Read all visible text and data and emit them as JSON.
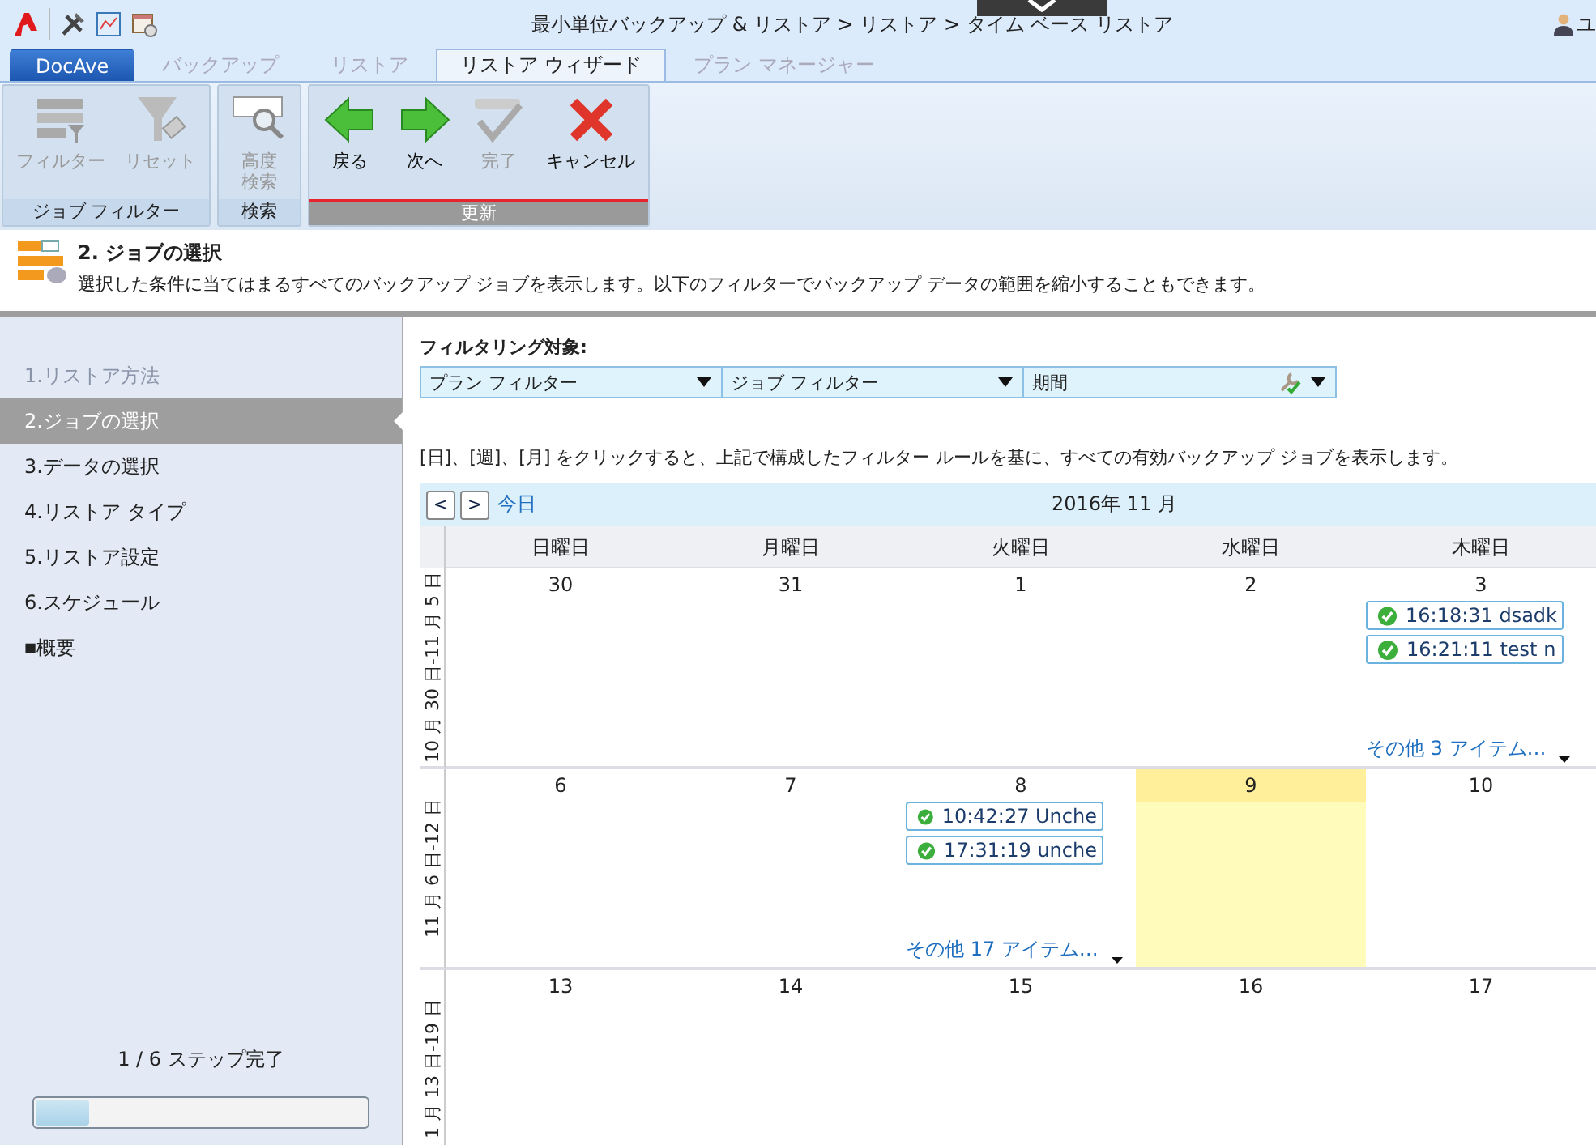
{
  "top_bar": {
    "breadcrumb": "最小単位バックアップ & リストア > リストア > タイム ベース リストア",
    "user": "ユ"
  },
  "tabs": [
    {
      "label": "DocAve",
      "kind": "app",
      "selected": false,
      "disabled": false
    },
    {
      "label": "バックアップ",
      "kind": "tab",
      "selected": false,
      "disabled": true
    },
    {
      "label": "リストア",
      "kind": "tab",
      "selected": false,
      "disabled": true
    },
    {
      "label": "リストア ウィザード",
      "kind": "tab",
      "selected": true,
      "disabled": false
    },
    {
      "label": "プラン マネージャー",
      "kind": "tab",
      "selected": false,
      "disabled": true
    }
  ],
  "ribbon": [
    {
      "label": "ジョブ フィルター",
      "highlighted": false,
      "buttons": [
        {
          "label": "フィルター",
          "kind": "filter",
          "disabled": true
        },
        {
          "label": "リセット",
          "kind": "reset",
          "disabled": true
        }
      ]
    },
    {
      "label": "検索",
      "highlighted": false,
      "buttons": [
        {
          "label": "高度検索",
          "kind": "search",
          "disabled": true
        }
      ]
    },
    {
      "label": "更新",
      "highlighted": true,
      "buttons": [
        {
          "label": "戻る",
          "kind": "back",
          "disabled": false
        },
        {
          "label": "次へ",
          "kind": "next",
          "disabled": false
        },
        {
          "label": "完了",
          "kind": "finish",
          "disabled": true
        },
        {
          "label": "キャンセル",
          "kind": "cancel",
          "disabled": false
        }
      ]
    }
  ],
  "header": {
    "title": "2. ジョブの選択",
    "description": "選択した条件に当てはまるすべてのバックアップ ジョブを表示します。以下のフィルターでバックアップ データの範囲を縮小することもできます。"
  },
  "steps": [
    {
      "label": "1.リストア方法",
      "selected": false,
      "done": true
    },
    {
      "label": "2.ジョブの選択",
      "selected": true,
      "done": false
    },
    {
      "label": "3.データの選択",
      "selected": false,
      "done": false
    },
    {
      "label": "4.リストア タイプ",
      "selected": false,
      "done": false
    },
    {
      "label": "5.リストア設定",
      "selected": false,
      "done": false
    },
    {
      "label": "6.スケジュール",
      "selected": false,
      "done": false
    },
    {
      "label": "概要",
      "bullet": "■",
      "selected": false,
      "done": false
    }
  ],
  "progress": {
    "text": "1 / 6 ステップ完了",
    "level": 0.16
  },
  "filters": {
    "label": "フィルタリング対象:",
    "dropdowns": [
      {
        "label": "プラン フィルター",
        "configured": false
      },
      {
        "label": "ジョブ フィルター",
        "configured": false
      },
      {
        "label": "期間",
        "configured": true
      }
    ]
  },
  "instruction": "[日]、[週]、[月] をクリックすると、上記で構成したフィルター ルールを基に、すべての有効バックアップ ジョブを表示します。",
  "calendar": {
    "prev": "<",
    "next": ">",
    "today": "今日",
    "month": "2016年 11 月",
    "weekdays": [
      "日曜日",
      "月曜日",
      "火曜日",
      "水曜日",
      "木曜日"
    ],
    "weeks": [
      {
        "label": "10 月 30 日-11 月 5 日",
        "days": [
          {
            "date": "30",
            "today": false
          },
          {
            "date": "31",
            "today": false
          },
          {
            "date": "1",
            "today": false
          },
          {
            "date": "2",
            "today": false
          },
          {
            "date": "3",
            "today": false,
            "events": [
              {
                "text": "16:18:31 dsadk"
              },
              {
                "text": "16:21:11 test n"
              }
            ],
            "more": "その他 3 アイテム…"
          }
        ]
      },
      {
        "label": "11 月 6 日-12 日",
        "days": [
          {
            "date": "6",
            "today": false
          },
          {
            "date": "7",
            "today": false
          },
          {
            "date": "8",
            "today": false,
            "events": [
              {
                "text": "10:42:27 Unche"
              },
              {
                "text": "17:31:19 unche"
              }
            ],
            "more": "その他 17 アイテム…"
          },
          {
            "date": "9",
            "today": true
          },
          {
            "date": "10",
            "today": false
          }
        ]
      },
      {
        "label": "1 月 13 日-19 日",
        "days": [
          {
            "date": "13",
            "today": false
          },
          {
            "date": "14",
            "today": false
          },
          {
            "date": "15",
            "today": false
          },
          {
            "date": "16",
            "today": false
          },
          {
            "date": "17",
            "today": false
          }
        ]
      }
    ]
  }
}
